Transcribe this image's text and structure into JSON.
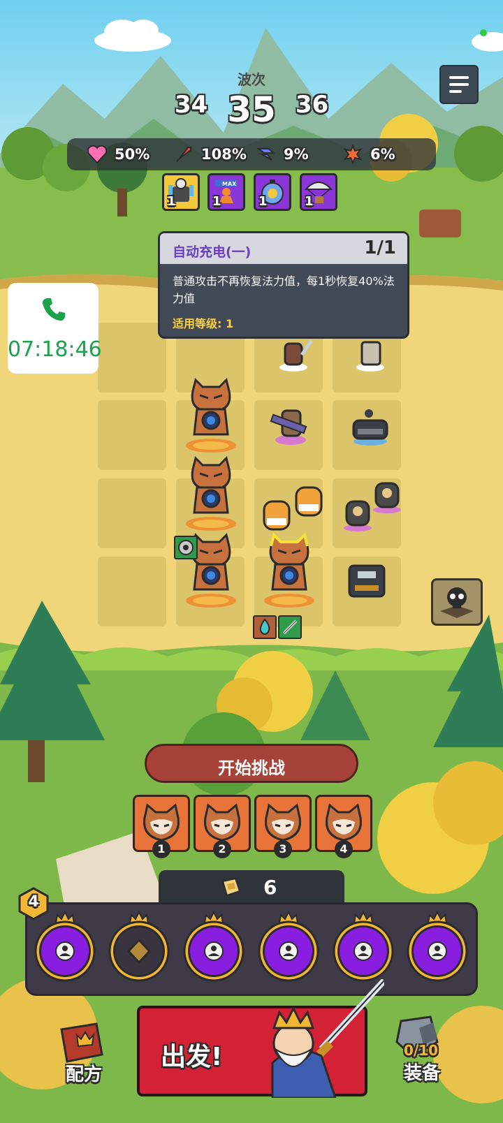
{
  "wave": {
    "label": "波次",
    "prev": "34",
    "current": "35",
    "next": "36"
  },
  "stats": [
    {
      "icon": "heart-icon",
      "value": "50%",
      "color": "#ff6fb2"
    },
    {
      "icon": "sword-icon",
      "value": "108%",
      "color": "#e8453c"
    },
    {
      "icon": "dodge-icon",
      "value": "9%",
      "color": "#6b7cff"
    },
    {
      "icon": "crit-icon",
      "value": "6%",
      "color": "#f06a3a"
    }
  ],
  "buffs": [
    {
      "name": "auto-charge-buff",
      "level": "1",
      "selected": true
    },
    {
      "name": "max-unit-buff",
      "level": "1",
      "badge": "MAX"
    },
    {
      "name": "timer-buff",
      "level": "1"
    },
    {
      "name": "airdrop-buff",
      "level": "1"
    }
  ],
  "tooltip": {
    "title": "自动充电(一)",
    "count": "1/1",
    "description": "普通攻击不再恢复法力值，每1秒恢复40%法力值",
    "level_text": "适用等级: 1"
  },
  "call": {
    "time": "07:18:46"
  },
  "start_button": "开始挑战",
  "cards": [
    {
      "number": "1"
    },
    {
      "number": "2"
    },
    {
      "number": "3"
    },
    {
      "number": "4"
    }
  ],
  "gold": "6",
  "hero_level": "4",
  "go_button": "出发!",
  "recipe_label": "配方",
  "equip_label": "装备",
  "equip_count": "0/10",
  "colors": {
    "accent_purple": "#7a1fd6",
    "gold": "#f2b632",
    "red": "#d32236"
  }
}
